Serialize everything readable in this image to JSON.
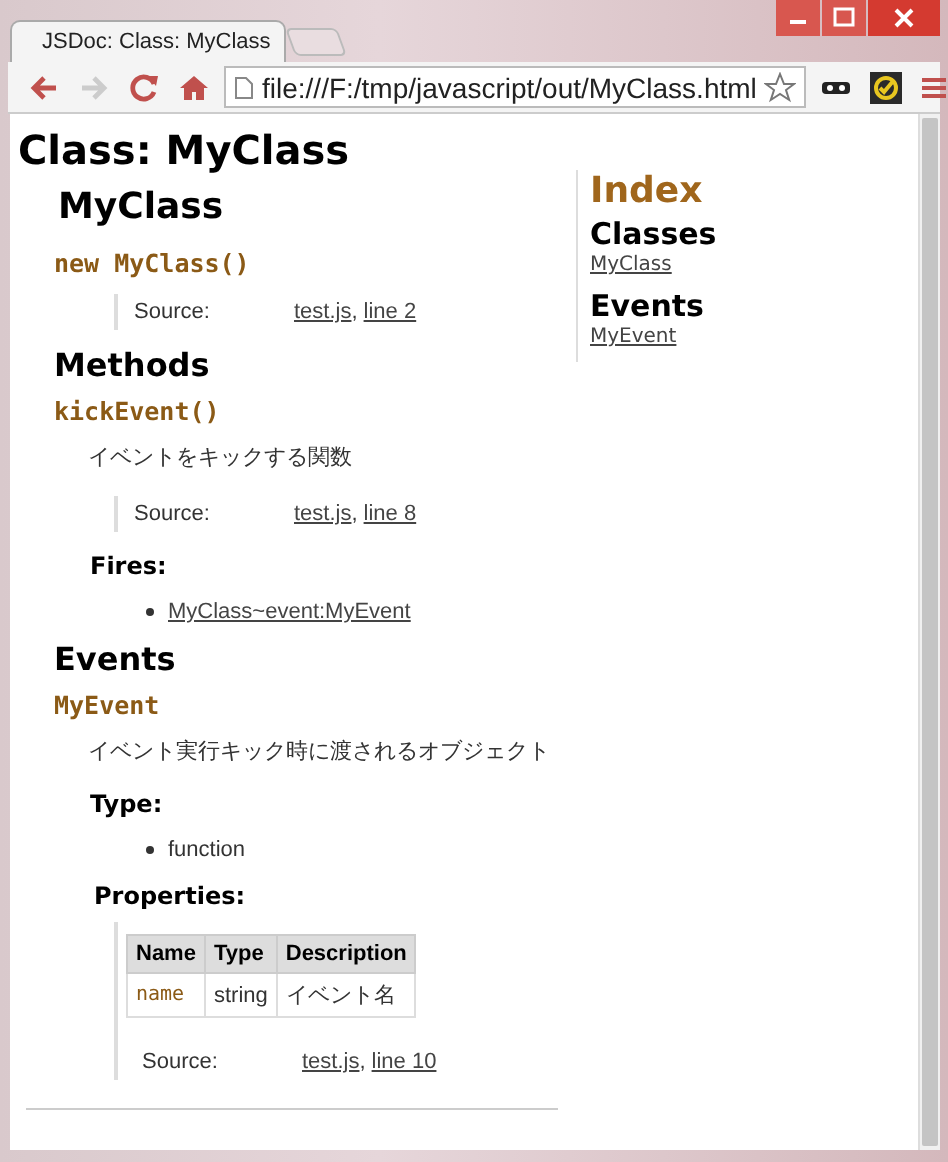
{
  "browser": {
    "tabs": [
      {
        "title": "JSDoc: Class: MyClass",
        "selected": true
      }
    ],
    "address": "file:///F:/tmp/javascript/out/MyClass.html"
  },
  "page": {
    "title": "Class: MyClass",
    "class_heading": "MyClass",
    "constructor": {
      "signature": "new MyClass()",
      "source": {
        "label": "Source:",
        "file": "test.js",
        "separator": ",",
        "line": "line 2"
      }
    },
    "methods_heading": "Methods",
    "methods": [
      {
        "signature": "kickEvent()",
        "description": "イベントをキックする関数",
        "source": {
          "label": "Source:",
          "file": "test.js",
          "separator": ",",
          "line": "line 8"
        },
        "fires_heading": "Fires:",
        "fires": [
          "MyClass~event:MyEvent"
        ]
      }
    ],
    "events_heading": "Events",
    "events": [
      {
        "signature": "MyEvent",
        "description": "イベント実行キック時に渡されるオブジェクト",
        "type_heading": "Type:",
        "types": [
          "function"
        ],
        "properties_heading": "Properties:",
        "properties": {
          "columns": [
            "Name",
            "Type",
            "Description"
          ],
          "rows": [
            [
              "name",
              "string",
              "イベント名"
            ]
          ]
        },
        "source": {
          "label": "Source:",
          "file": "test.js",
          "separator": ",",
          "line": "line 10"
        }
      }
    ]
  },
  "index": {
    "title": "Index",
    "groups": [
      {
        "heading": "Classes",
        "links": [
          "MyClass"
        ]
      },
      {
        "heading": "Events",
        "links": [
          "MyEvent"
        ]
      }
    ]
  }
}
